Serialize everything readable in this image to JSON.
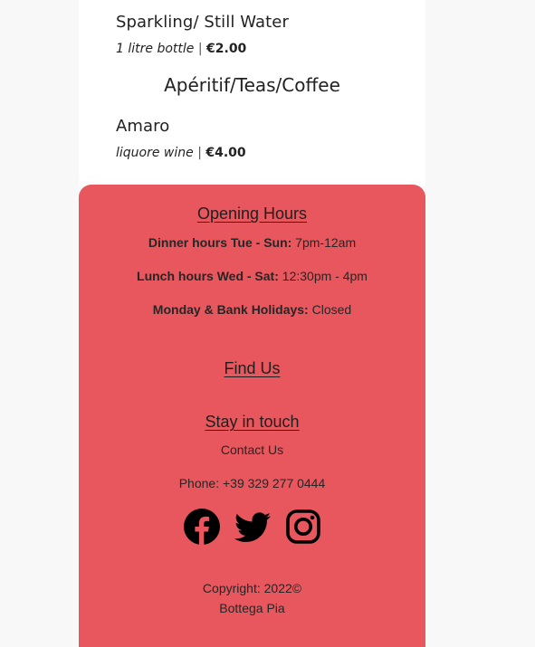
{
  "menu": {
    "item1": {
      "name": "Sparkling/ Still Water",
      "desc": "1 litre bottle",
      "sep": " | ",
      "price": "€2.00"
    },
    "section_heading": "Apéritif/Teas/Coffee",
    "item2": {
      "name": "Amaro",
      "desc": "liquore wine",
      "sep": " | ",
      "price": "€4.00"
    }
  },
  "footer": {
    "opening_title": "Opening Hours",
    "hours": [
      {
        "label": "Dinner hours Tue - Sun:",
        "value": " 7pm-12am"
      },
      {
        "label": "Lunch hours Wed - Sat:",
        "value": " 12:30pm - 4pm"
      },
      {
        "label": "Monday & Bank Holidays:",
        "value": " Closed"
      }
    ],
    "find_title": "Find Us",
    "contact_title": "Stay in touch",
    "contact_link": "Contact Us",
    "phone": "Phone: +39 329 277 0444",
    "social_icons": [
      "facebook-icon",
      "twitter-icon",
      "instagram-icon"
    ],
    "copyright": "Copyright: 2022©",
    "brand": "Bottega Pia"
  },
  "colors": {
    "footer_bg": "#e8575d",
    "page_bg": "#f8f8f8"
  }
}
